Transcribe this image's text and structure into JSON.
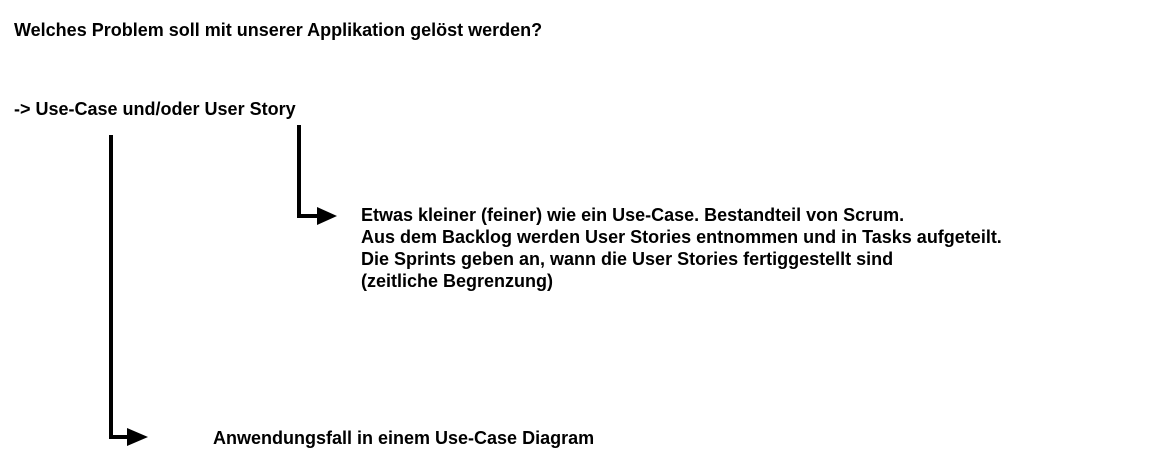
{
  "question": "Welches Problem soll mit unserer Applikation gelöst werden?",
  "use_case_line": "-> Use-Case und/oder User Story",
  "user_story_notes": [
    "Etwas kleiner (feiner) wie ein Use-Case. Bestandteil von Scrum.",
    "Aus dem Backlog werden User Stories entnommen und in Tasks aufgeteilt.",
    "Die Sprints geben an, wann die User Stories fertiggestellt sind",
    "(zeitliche Begrenzung)"
  ],
  "use_case_note": "Anwendungsfall in einem Use-Case Diagram"
}
